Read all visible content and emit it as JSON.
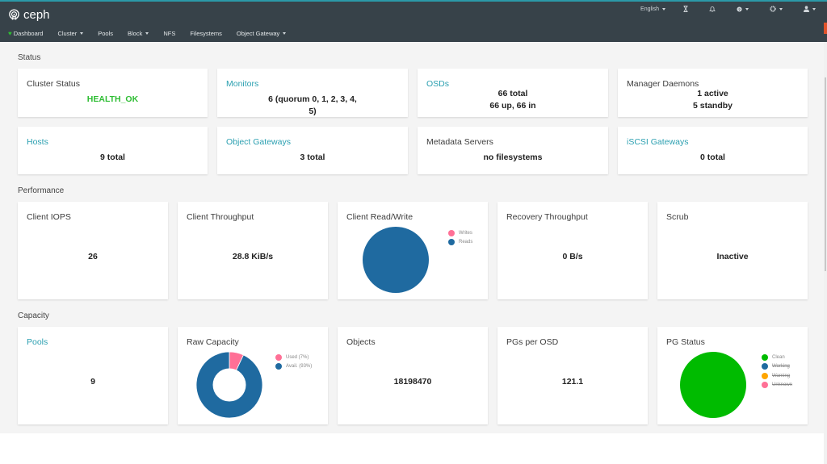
{
  "header": {
    "brand": "ceph",
    "language": "English",
    "icons": [
      "hourglass-icon",
      "bell-icon",
      "help-icon",
      "gear-icon",
      "user-icon"
    ]
  },
  "nav": {
    "items": [
      {
        "label": "Dashboard",
        "active": true,
        "icon": "heart-icon"
      },
      {
        "label": "Cluster",
        "dropdown": true
      },
      {
        "label": "Pools"
      },
      {
        "label": "Block",
        "dropdown": true
      },
      {
        "label": "NFS"
      },
      {
        "label": "Filesystems"
      },
      {
        "label": "Object Gateway",
        "dropdown": true
      }
    ]
  },
  "status": {
    "title": "Status",
    "cards": {
      "cluster_status": {
        "title": "Cluster Status",
        "value": "HEALTH_OK",
        "color": "#2ebd33"
      },
      "monitors": {
        "title": "Monitors",
        "line1": "6 (quorum 0, 1, 2, 3, 4,",
        "line2": "5)"
      },
      "osds": {
        "title": "OSDs",
        "line1": "66 total",
        "line2": "66 up, 66 in"
      },
      "manager_daemons": {
        "title": "Manager Daemons",
        "line1": "1 active",
        "line2": "5 standby"
      },
      "hosts": {
        "title": "Hosts",
        "value": "9 total"
      },
      "object_gateways": {
        "title": "Object Gateways",
        "value": "3 total"
      },
      "metadata_servers": {
        "title": "Metadata Servers",
        "value": "no filesystems"
      },
      "iscsi_gateways": {
        "title": "iSCSI Gateways",
        "value": "0 total"
      }
    }
  },
  "performance": {
    "title": "Performance",
    "cards": {
      "client_iops": {
        "title": "Client IOPS",
        "value": "26"
      },
      "client_throughput": {
        "title": "Client Throughput",
        "value": "28.8 KiB/s"
      },
      "client_read_write": {
        "title": "Client Read/Write"
      },
      "recovery_throughput": {
        "title": "Recovery Throughput",
        "value": "0 B/s"
      },
      "scrub": {
        "title": "Scrub",
        "value": "Inactive"
      }
    }
  },
  "capacity": {
    "title": "Capacity",
    "cards": {
      "pools": {
        "title": "Pools",
        "value": "9"
      },
      "raw_capacity": {
        "title": "Raw Capacity"
      },
      "objects": {
        "title": "Objects",
        "value": "18198470"
      },
      "pgs_per_osd": {
        "title": "PGs per OSD",
        "value": "121.1"
      },
      "pg_status": {
        "title": "PG Status"
      }
    }
  },
  "chart_data": [
    {
      "type": "pie",
      "title": "Client Read/Write",
      "legend": "right",
      "slices": [
        {
          "label": "Writes",
          "value": 0,
          "color": "#ff7096"
        },
        {
          "label": "Reads",
          "value": 100,
          "color": "#1f6aa0"
        }
      ]
    },
    {
      "type": "pie",
      "title": "Raw Capacity",
      "donut": true,
      "legend": "right",
      "slices": [
        {
          "label": "Used (7%)",
          "value": 7,
          "color": "#ff7096"
        },
        {
          "label": "Avail. (93%)",
          "value": 93,
          "color": "#1f6aa0"
        }
      ]
    },
    {
      "type": "pie",
      "title": "PG Status",
      "legend": "right",
      "slices": [
        {
          "label": "Clean",
          "value": 100,
          "color": "#00bb00",
          "hidden": false
        },
        {
          "label": "Working",
          "value": 0,
          "color": "#1f6aa0",
          "hidden": true
        },
        {
          "label": "Warning",
          "value": 0,
          "color": "#ffa500",
          "hidden": true
        },
        {
          "label": "Unknown",
          "value": 0,
          "color": "#ff7096",
          "hidden": true
        }
      ]
    }
  ]
}
